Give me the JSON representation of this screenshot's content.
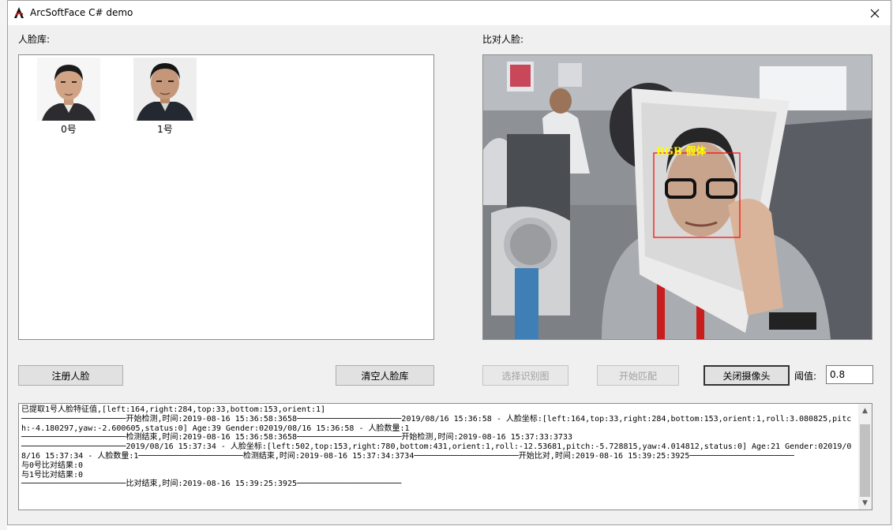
{
  "window": {
    "title": "ArcSoftFace C# demo"
  },
  "face_library": {
    "label": "人脸库:",
    "faces": [
      {
        "caption": "0号"
      },
      {
        "caption": "1号"
      }
    ]
  },
  "compare": {
    "label": "比对人脸:",
    "detection_label": "RGB 假体"
  },
  "buttons": {
    "register": "注册人脸",
    "clear": "清空人脸库",
    "select_image": "选择识别图",
    "start_match": "开始匹配",
    "close_camera": "关闭摄像头"
  },
  "threshold": {
    "label": "阈值:",
    "value": "0.8"
  },
  "log": {
    "text": "已提取1号人脸特征值,[left:164,right:284,top:33,bottom:153,orient:1]\n──────────────────────开始检测,时间:2019-08-16 15:36:58:3658──────────────────────2019/08/16 15:36:58 - 人脸坐标:[left:164,top:33,right:284,bottom:153,orient:1,roll:3.080825,pitch:-4.180297,yaw:-2.600605,status:0] Age:39 Gender:02019/08/16 15:36:58 - 人脸数量:1\n──────────────────────检测结束,时间:2019-08-16 15:36:58:3658──────────────────────开始检测,时间:2019-08-16 15:37:33:3733\n──────────────────────2019/08/16 15:37:34 - 人脸坐标:[left:502,top:153,right:780,bottom:431,orient:1,roll:-12.53681,pitch:-5.728815,yaw:4.014812,status:0] Age:21 Gender:02019/08/16 15:37:34 - 人脸数量:1──────────────────────检测结束,时间:2019-08-16 15:37:34:3734──────────────────────开始比对,时间:2019-08-16 15:39:25:3925──────────────────────\n与0号比对结果:0\n与1号比对结果:0\n──────────────────────比对结束,时间:2019-08-16 15:39:25:3925──────────────────────"
  },
  "colors": {
    "detection_box": "#ff0000",
    "detection_text": "#ffff00",
    "accent": "#0078d7"
  }
}
